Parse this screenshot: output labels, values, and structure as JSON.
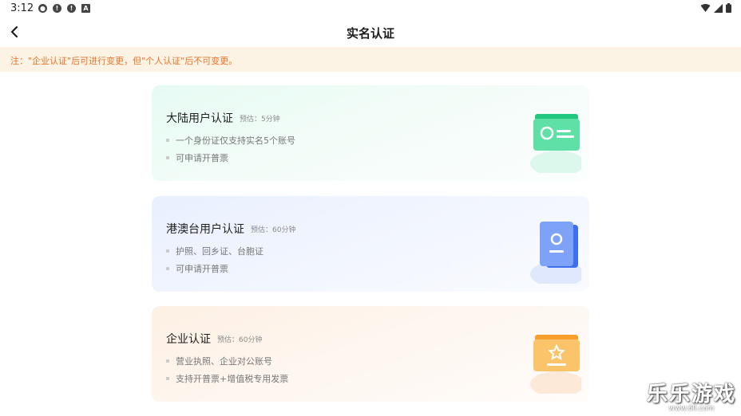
{
  "status": {
    "time": "3:12",
    "icons": [
      "notification-icon",
      "alert-icon",
      "alert-icon",
      "a-icon"
    ],
    "right_icons": [
      "wifi-icon",
      "signal-icon",
      "battery-icon"
    ]
  },
  "header": {
    "title": "实名认证",
    "back_icon": "chevron-left-icon"
  },
  "notice": {
    "text": "注：\"企业认证\"后可进行变更，但\"个人认证\"后不可变更。"
  },
  "cards": [
    {
      "title": "大陆用户认证",
      "estimate": "预估：5分钟",
      "bullets": [
        "一个身份证仅支持实名5个账号",
        "可申请开普票"
      ],
      "icon": "id-card-icon",
      "accent": "#2ecf8c"
    },
    {
      "title": "港澳台用户认证",
      "estimate": "预估：60分钟",
      "bullets": [
        "护照、回乡证、台胞证",
        "可申请开普票"
      ],
      "icon": "passport-icon",
      "accent": "#4d7ff5"
    },
    {
      "title": "企业认证",
      "estimate": "预估：60分钟",
      "bullets": [
        "营业执照、企业对公账号",
        "支持开普票+增值税专用发票"
      ],
      "icon": "enterprise-star-icon",
      "accent": "#f8a43a"
    }
  ],
  "watermark": {
    "main": "乐乐游戏",
    "url": "www.6ll.com"
  }
}
